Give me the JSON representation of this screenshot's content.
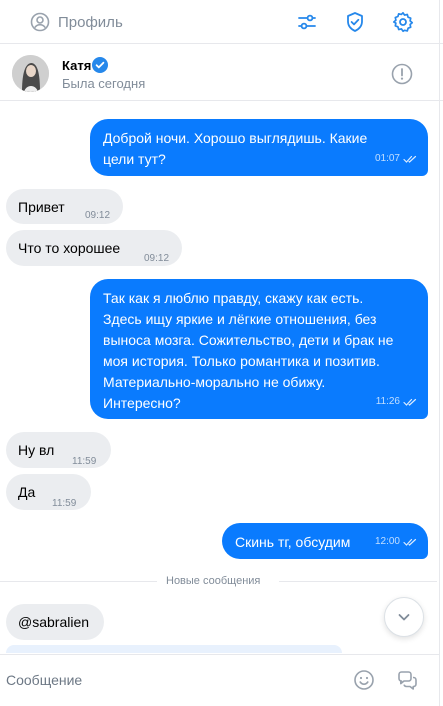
{
  "toolbar": {
    "profile_label": "Профиль",
    "icons": [
      "user-circle-icon",
      "filters-icon",
      "shield-check-icon",
      "gear-icon"
    ]
  },
  "chat": {
    "contact_name": "Катя",
    "status": "Была сегодня",
    "verified": true
  },
  "messages": [
    {
      "direction": "out",
      "text": "Доброй ночи. Хорошо выглядишь. Какие\nцели тут?",
      "time": "01:07",
      "read": true
    },
    {
      "direction": "in",
      "text": "Привет",
      "time": "09:12"
    },
    {
      "direction": "in",
      "text": "Что то хорошее",
      "time": "09:12"
    },
    {
      "direction": "out",
      "text": "Так как я люблю правду, скажу как есть.\nЗдесь ищу яркие и лёгкие отношения, без\nвыноса мозга. Сожительство, дети и брак не\nмоя история. Только романтика и позитив.\nМатериально-морально не обижу.\nИнтересно?",
      "time": "11:26",
      "read": true
    },
    {
      "direction": "in",
      "text": "Ну вл",
      "time": "11:59"
    },
    {
      "direction": "in",
      "text": "Да",
      "time": "11:59"
    },
    {
      "direction": "out",
      "text": "Скинь тг, обсудим",
      "time": "12:00",
      "read": true
    }
  ],
  "new_messages_label": "Новые сообщения",
  "new_messages": [
    {
      "direction": "in",
      "text": "@sabralien"
    }
  ],
  "composer": {
    "placeholder": "Сообщение"
  },
  "colors": {
    "accent": "#0a7bfe",
    "incoming_bubble": "#ebedf0",
    "muted_text": "#818c99",
    "icon": "#2688eb"
  }
}
